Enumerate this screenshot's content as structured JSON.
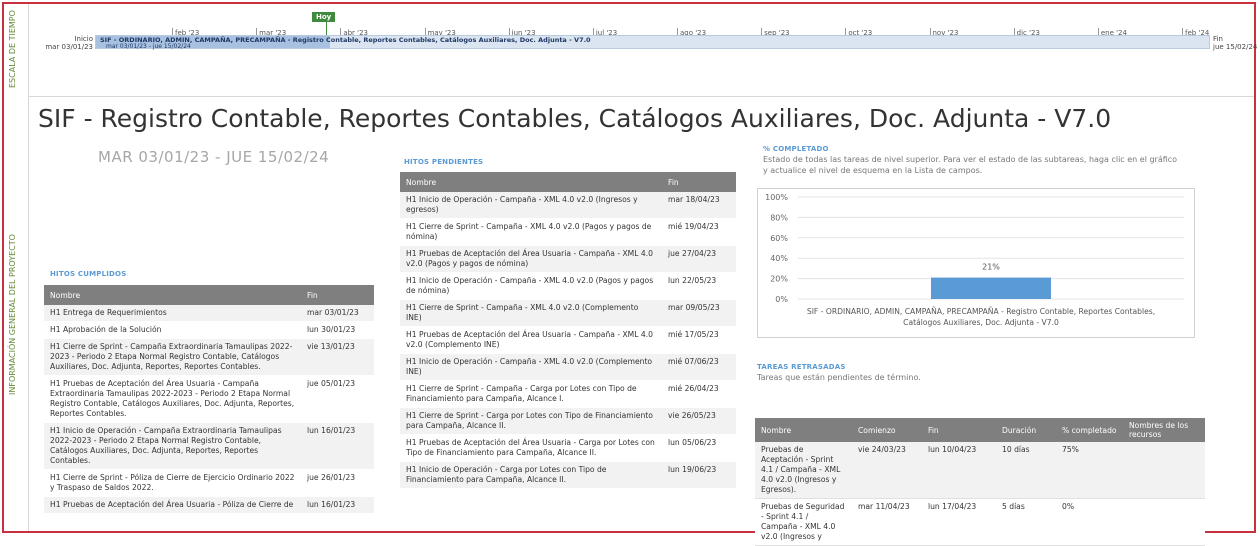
{
  "side_labels": {
    "timeline": "ESCALA DE TIEMPO",
    "overview": "INFORMACIÓN GENERAL DEL PROYECTO"
  },
  "timeline": {
    "today_label": "Hoy",
    "start_label": "Inicio",
    "start_date": "mar 03/01/23",
    "end_label": "Fin",
    "end_date": "jue 15/02/24",
    "months": [
      "feb '23",
      "mar '23",
      "abr '23",
      "may '23",
      "jun '23",
      "jul '23",
      "ago '23",
      "sep '23",
      "oct '23",
      "nov '23",
      "dic '23",
      "ene '24",
      "feb '24"
    ],
    "bar_title": "SIF - ORDINARIO, ADMIN, CAMPAÑA, PRECAMPAÑA - Registro Contable, Reportes Contables, Catálogos Auxiliares, Doc. Adjunta - V7.0",
    "bar_dates": "mar 03/01/23 - jue 15/02/24",
    "progress_fraction": 0.21
  },
  "project": {
    "title": "SIF - Registro Contable, Reportes Contables, Catálogos Auxiliares, Doc. Adjunta - V7.0",
    "dates": "MAR 03/01/23 - JUE 15/02/24"
  },
  "hitos_cumplidos": {
    "label": "HITOS CUMPLIDOS",
    "columns": [
      "Nombre",
      "Fin"
    ],
    "rows": [
      [
        "H1 Entrega de Requerimientos",
        "mar 03/01/23"
      ],
      [
        "H1 Aprobación de la Solución",
        "lun 30/01/23"
      ],
      [
        "H1 Cierre de Sprint - Campaña Extraordinaria Tamaulipas 2022-2023 - Periodo 2 Etapa Normal Registro Contable, Catálogos Auxiliares, Doc. Adjunta, Reportes, Reportes Contables.",
        "vie 13/01/23"
      ],
      [
        "H1 Pruebas de Aceptación del Área Usuaria - Campaña Extraordinaria Tamaulipas 2022-2023 - Periodo 2 Etapa Normal Registro Contable, Catálogos Auxiliares, Doc. Adjunta, Reportes, Reportes Contables.",
        "jue 05/01/23"
      ],
      [
        "H1 Inicio de Operación - Campaña Extraordinaria Tamaulipas 2022-2023 - Periodo 2 Etapa Normal Registro Contable, Catálogos Auxiliares, Doc. Adjunta, Reportes, Reportes Contables.",
        "lun 16/01/23"
      ],
      [
        "H1 Cierre de Sprint - Póliza de Cierre de Ejercicio Ordinario 2022 y Traspaso de Saldos 2022.",
        "jue 26/01/23"
      ],
      [
        "H1 Pruebas de Aceptación del Área Usuaria - Póliza de Cierre de",
        "lun 16/01/23"
      ]
    ]
  },
  "hitos_pendientes": {
    "label": "HITOS PENDIENTES",
    "columns": [
      "Nombre",
      "Fin"
    ],
    "rows": [
      [
        "H1 Inicio de Operación - Campaña - XML 4.0 v2.0 (Ingresos y egresos)",
        "mar 18/04/23"
      ],
      [
        "H1 Cierre de Sprint - Campaña - XML 4.0 v2.0 (Pagos y pagos de nómina)",
        "mié 19/04/23"
      ],
      [
        "H1 Pruebas de Aceptación del Área Usuaria - Campaña - XML 4.0 v2.0 (Pagos y pagos de nómina)",
        "jue 27/04/23"
      ],
      [
        "H1 Inicio de Operación - Campaña - XML 4.0 v2.0 (Pagos y pagos de nómina)",
        "lun 22/05/23"
      ],
      [
        "H1 Cierre de Sprint - Campaña - XML 4.0 v2.0 (Complemento INE)",
        "mar 09/05/23"
      ],
      [
        "H1 Pruebas de Aceptación del Área Usuaria - Campaña - XML 4.0 v2.0 (Complemento INE)",
        "mié 17/05/23"
      ],
      [
        "H1 Inicio de Operación - Campaña - XML 4.0 v2.0 (Complemento INE)",
        "mié 07/06/23"
      ],
      [
        "H1 Cierre de Sprint - Campaña - Carga por Lotes con Tipo de Financiamiento para Campaña, Alcance I.",
        "mié 26/04/23"
      ],
      [
        "H1 Cierre de Sprint - Carga por Lotes con Tipo de Financiamiento para Campaña, Alcance II.",
        "vie 26/05/23"
      ],
      [
        "H1 Pruebas de Aceptación del Área Usuaria - Carga por Lotes con Tipo de Financiamiento para Campaña, Alcance II.",
        "lun 05/06/23"
      ],
      [
        "H1 Inicio de Operación - Carga por Lotes con Tipo de Financiamiento para Campaña, Alcance II.",
        "lun 19/06/23"
      ]
    ]
  },
  "completado": {
    "label": "% COMPLETADO",
    "description": "Estado de todas las tareas de nivel superior. Para ver el estado de las subtareas, haga clic en el gráfico y actualice el nivel de esquema en la Lista de campos."
  },
  "chart_data": {
    "type": "bar",
    "categories": [
      "SIF - ORDINARIO, ADMIN, CAMPAÑA, PRECAMPAÑA - Registro Contable, Reportes Contables, Catálogos Auxiliares, Doc. Adjunta - V7.0"
    ],
    "category_lines": [
      "SIF - ORDINARIO, ADMIN, CAMPAÑA, PRECAMPAÑA - Registro Contable, Reportes Contables,",
      "Catálogos Auxiliares, Doc. Adjunta - V7.0"
    ],
    "values": [
      21
    ],
    "data_labels": [
      "21%"
    ],
    "ylim": [
      0,
      100
    ],
    "yticks": [
      "0%",
      "20%",
      "40%",
      "60%",
      "80%",
      "100%"
    ],
    "grid": true,
    "bar_color": "#5b9bd5"
  },
  "tareas_retrasadas": {
    "label": "TAREAS RETRASADAS",
    "description": "Tareas que están pendientes de término.",
    "columns": [
      "Nombre",
      "Comienzo",
      "Fin",
      "Duración",
      "% completado",
      "Nombres de los recursos"
    ],
    "rows": [
      [
        "Pruebas de Aceptación - Sprint 4.1 / Campaña - XML 4.0 v2.0 (Ingresos y Egresos).",
        "vie 24/03/23",
        "lun 10/04/23",
        "10 días",
        "75%",
        ""
      ],
      [
        "Pruebas de Seguridad - Sprint 4.1 / Campaña - XML 4.0 v2.0 (Ingresos y",
        "mar 11/04/23",
        "lun 17/04/23",
        "5 días",
        "0%",
        ""
      ]
    ]
  }
}
